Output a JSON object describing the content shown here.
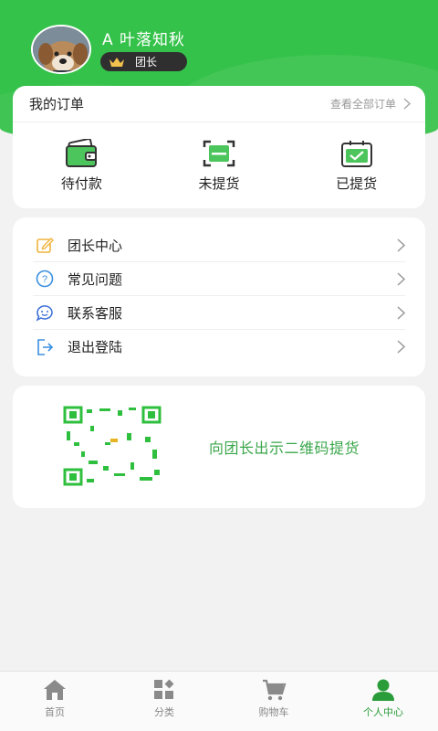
{
  "profile": {
    "username": "A 叶落知秋",
    "role": "团长"
  },
  "orders": {
    "title": "我的订单",
    "view_all": "查看全部订单",
    "items": [
      {
        "label": "待付款",
        "icon": "wallet-icon"
      },
      {
        "label": "未提货",
        "icon": "scan-icon"
      },
      {
        "label": "已提货",
        "icon": "checked-box-icon"
      }
    ]
  },
  "menu": [
    {
      "label": "团长中心",
      "icon": "edit-icon"
    },
    {
      "label": "常见问题",
      "icon": "question-icon"
    },
    {
      "label": "联系客服",
      "icon": "service-icon"
    },
    {
      "label": "退出登陆",
      "icon": "logout-icon"
    }
  ],
  "qr": {
    "text": "向团长出示二维码提货"
  },
  "tabbar": [
    {
      "label": "首页",
      "icon": "home-icon",
      "active": false
    },
    {
      "label": "分类",
      "icon": "category-icon",
      "active": false
    },
    {
      "label": "购物车",
      "icon": "cart-icon",
      "active": false
    },
    {
      "label": "个人中心",
      "icon": "user-icon",
      "active": true
    }
  ],
  "colors": {
    "brand_green": "#35c24a",
    "active_tab": "#2b9c3a",
    "qr_text": "#3aa64a"
  }
}
